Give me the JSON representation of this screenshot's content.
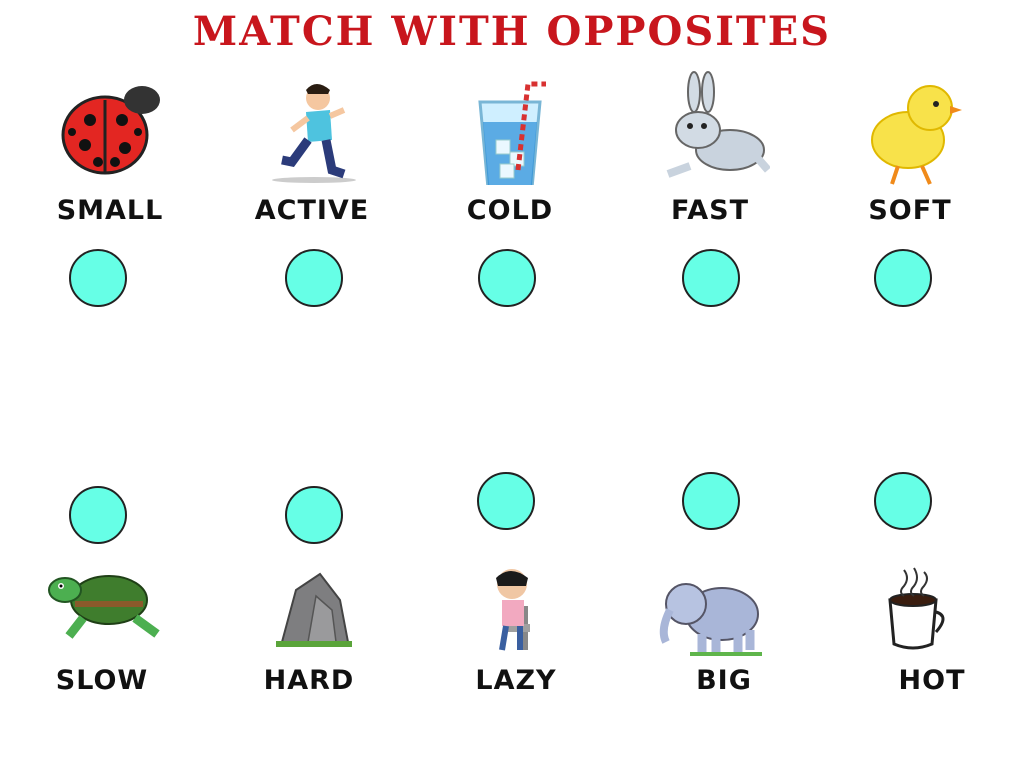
{
  "title": "MATCH WITH OPPOSITES",
  "top_row": [
    {
      "label": "SMALL",
      "icon": "ladybug-icon"
    },
    {
      "label": "ACTIVE",
      "icon": "running-boy-icon"
    },
    {
      "label": "COLD",
      "icon": "ice-water-glass-icon"
    },
    {
      "label": "FAST",
      "icon": "rabbit-icon"
    },
    {
      "label": "SOFT",
      "icon": "chick-icon"
    }
  ],
  "bottom_row": [
    {
      "label": "SLOW",
      "icon": "turtle-icon"
    },
    {
      "label": "HARD",
      "icon": "rock-icon"
    },
    {
      "label": "LAZY",
      "icon": "sitting-kid-icon"
    },
    {
      "label": "BIG",
      "icon": "elephant-icon"
    },
    {
      "label": "HOT",
      "icon": "hot-coffee-icon"
    }
  ],
  "colors": {
    "title": "#c8161d",
    "dot": "#66ffe6"
  }
}
